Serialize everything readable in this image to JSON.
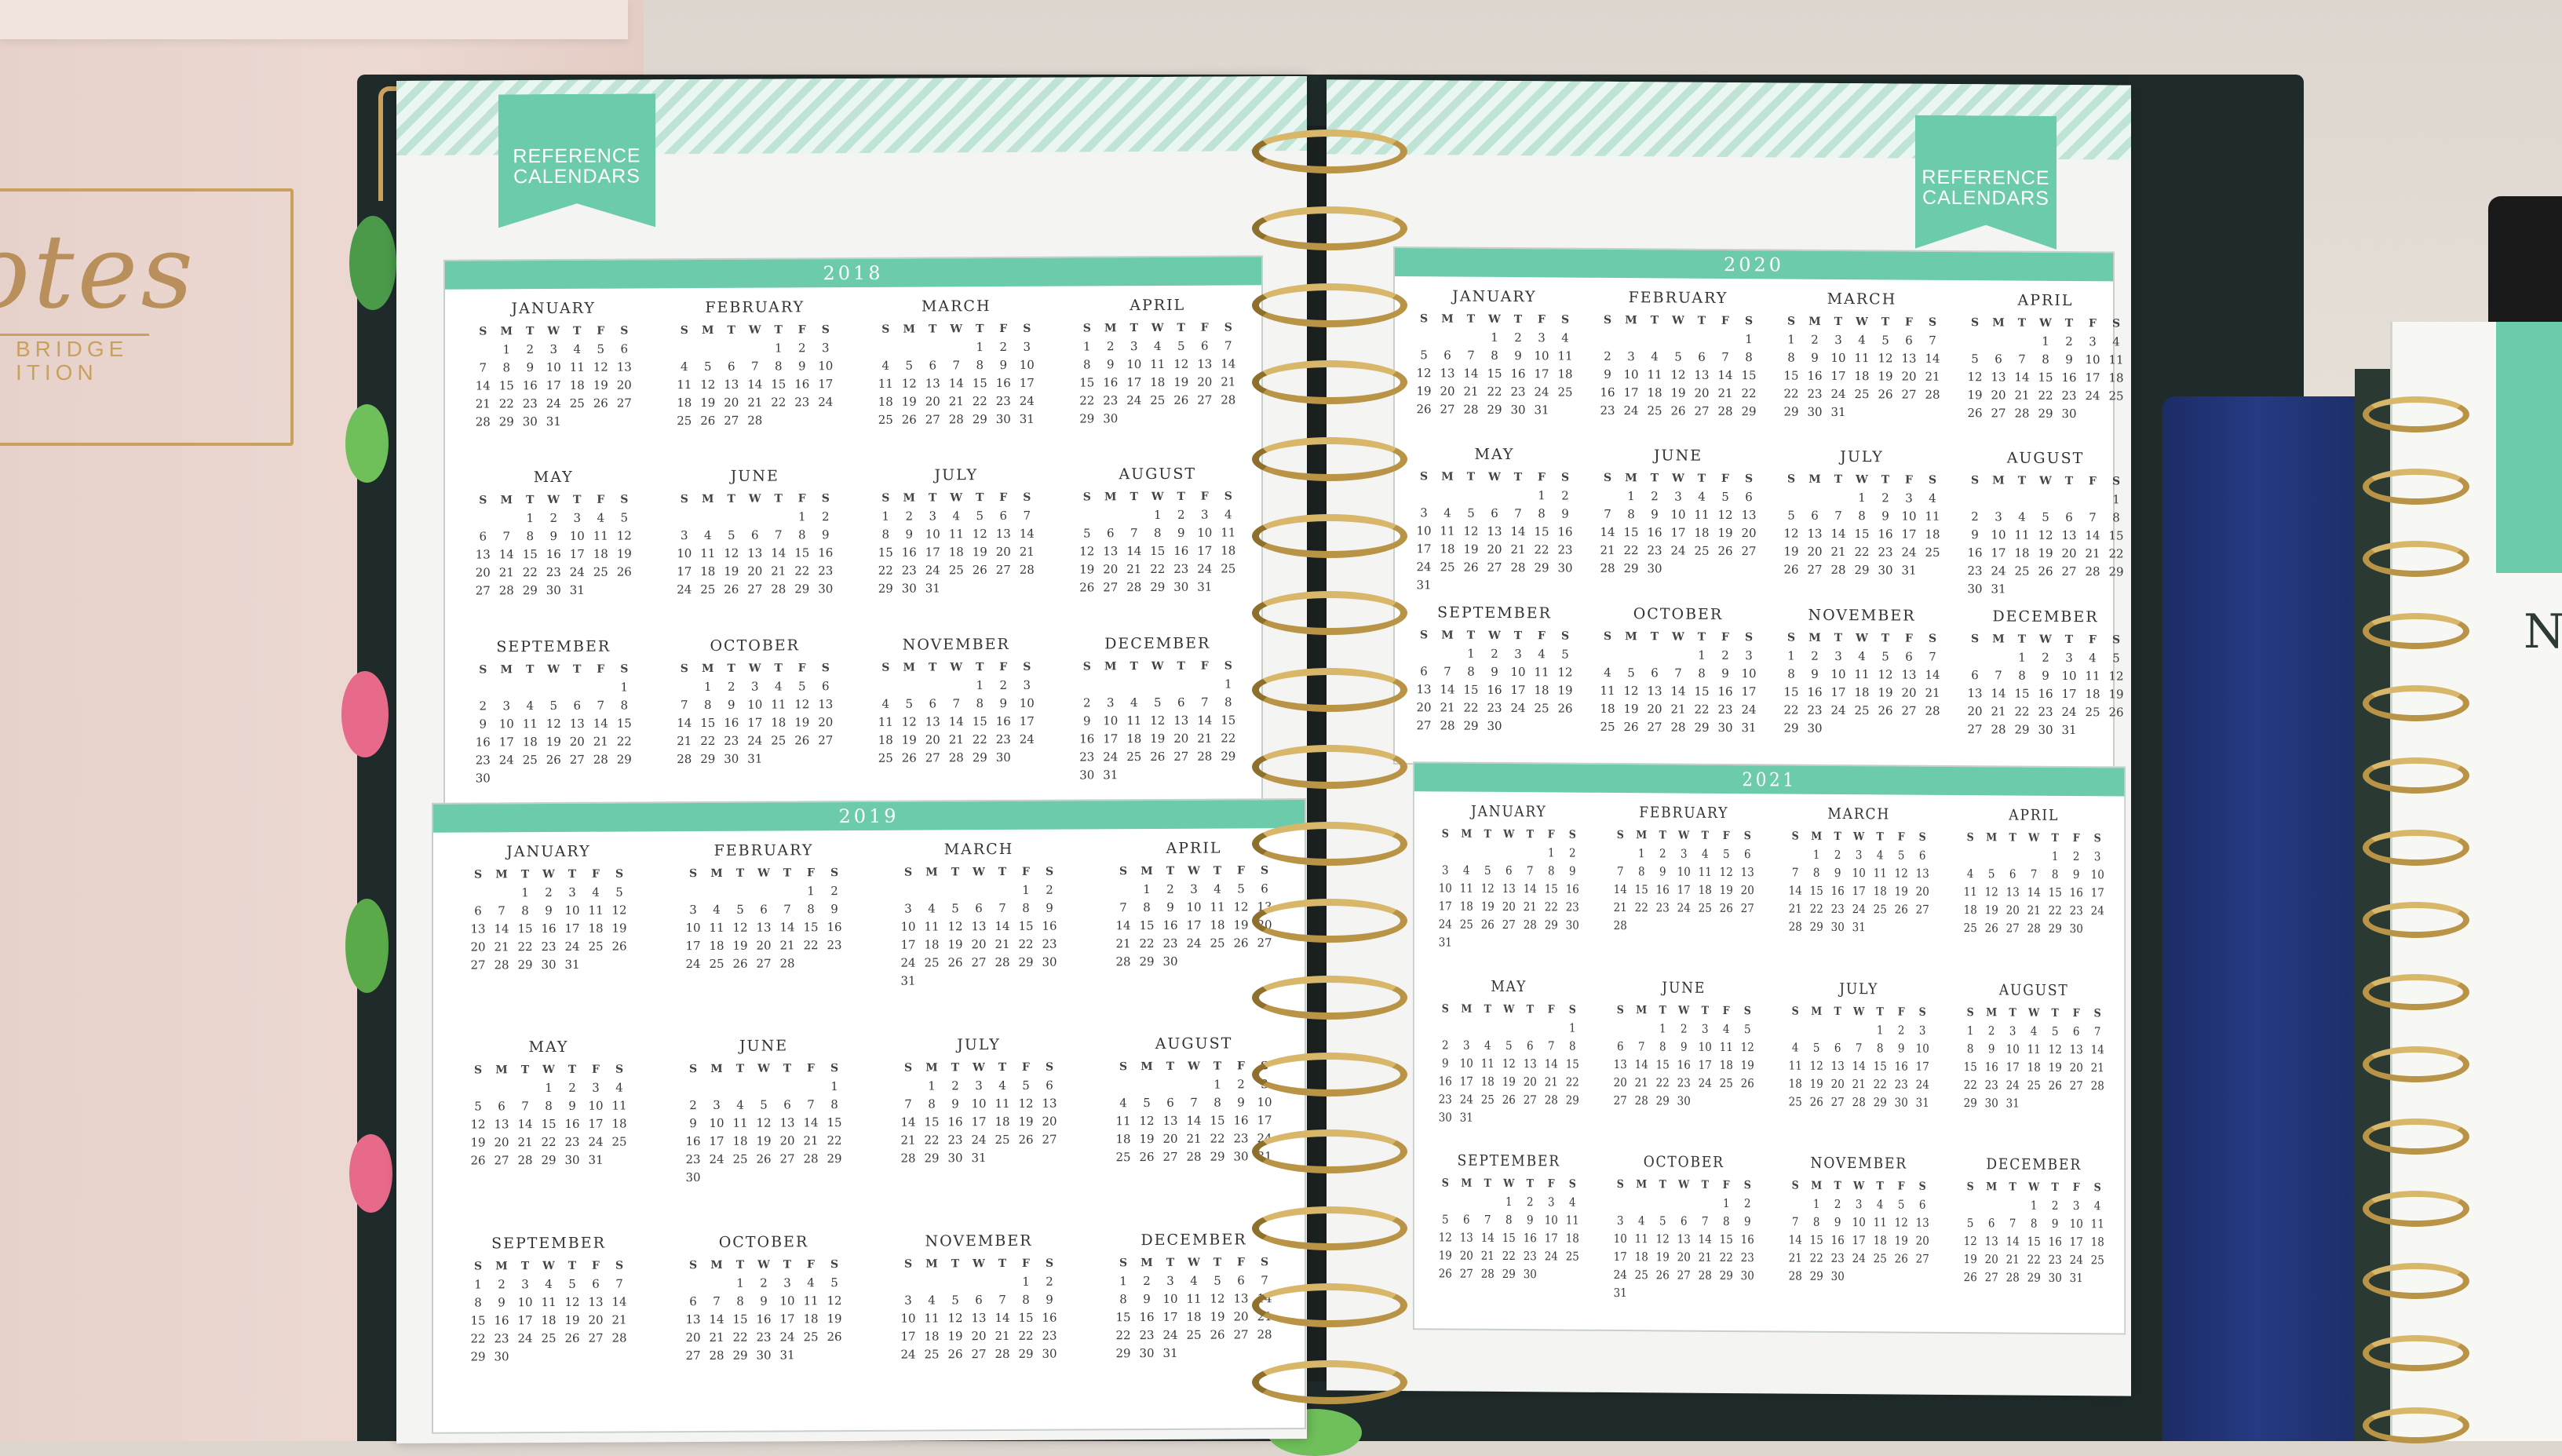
{
  "notes_book": {
    "title": "otes",
    "subtitle_line1": "BRIDGE",
    "subtitle_line2": "ITION"
  },
  "ribbon_label_line1": "REFERENCE",
  "ribbon_label_line2": "CALENDARS",
  "right_planner_letter": "N",
  "colors": {
    "accent_mint": "#6ccbaa",
    "page": "#f4f4f2",
    "cover_dark": "#1f2b2a",
    "coil_gold": "#b99446",
    "blue_book": "#243a82",
    "notes_pink": "#ecd9d2"
  },
  "weekday_letters": [
    "S",
    "M",
    "T",
    "W",
    "T",
    "F",
    "S"
  ],
  "calendars": [
    {
      "year": "2018",
      "first_weekdays": [
        1,
        4,
        4,
        0,
        2,
        5,
        0,
        3,
        6,
        1,
        4,
        6
      ]
    },
    {
      "year": "2019",
      "first_weekdays": [
        2,
        5,
        5,
        1,
        3,
        6,
        1,
        4,
        0,
        2,
        5,
        0
      ]
    },
    {
      "year": "2020",
      "first_weekdays": [
        3,
        6,
        0,
        3,
        5,
        1,
        3,
        6,
        2,
        4,
        0,
        2
      ]
    },
    {
      "year": "2021",
      "first_weekdays": [
        5,
        1,
        1,
        4,
        6,
        2,
        4,
        0,
        3,
        5,
        1,
        3
      ]
    }
  ],
  "month_names": [
    "JANUARY",
    "FEBRUARY",
    "MARCH",
    "APRIL",
    "MAY",
    "JUNE",
    "JULY",
    "AUGUST",
    "SEPTEMBER",
    "OCTOBER",
    "NOVEMBER",
    "DECEMBER"
  ]
}
